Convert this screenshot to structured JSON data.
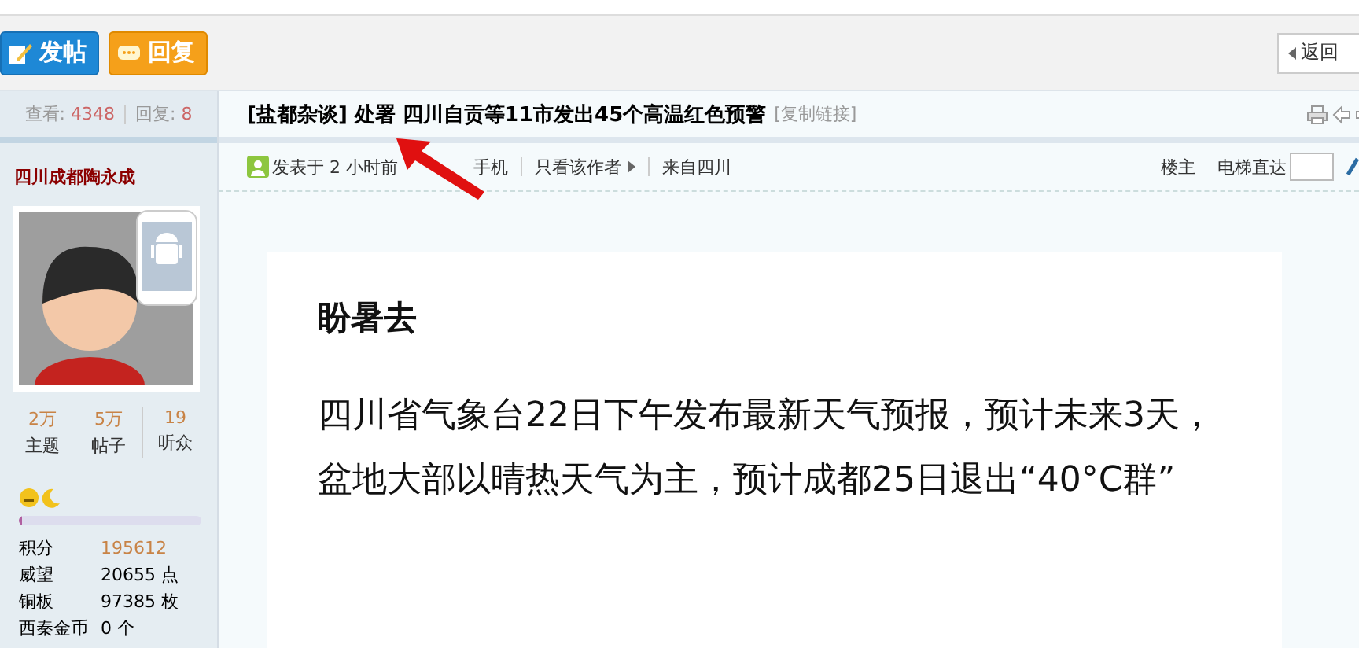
{
  "toolbar": {
    "buttons": [
      {
        "label": "发帖",
        "kind": "post"
      },
      {
        "label": "回复",
        "kind": "reply"
      }
    ],
    "back_button": "返回"
  },
  "thread_stats": {
    "views_label": "查看:",
    "views": "4348",
    "replies_label": "回复:",
    "replies": "8"
  },
  "thread_title": {
    "forum": "[盐都杂谈]",
    "title": "处署 四川自贡等11市发出45个高温红色预警",
    "copy_link": "[复制链接]"
  },
  "author": {
    "name": "四川成都陶永成",
    "stats": [
      {
        "value": "2万",
        "label": "主题"
      },
      {
        "value": "5万",
        "label": "帖子"
      },
      {
        "value": "19",
        "label": "听众"
      }
    ],
    "level": 0.02,
    "info": [
      {
        "label": "积分",
        "value": "195612",
        "highlight": true
      },
      {
        "label": "威望",
        "value": "20655 点",
        "highlight": false
      },
      {
        "label": "铜板",
        "value": "97385 枚",
        "highlight": false
      },
      {
        "label": "西秦金币",
        "value": "0 个",
        "highlight": false
      }
    ]
  },
  "post_meta": {
    "posted": "发表于 2 小时前",
    "device": "手机",
    "only_author": "只看该作者",
    "from": "来自四川",
    "floor": "楼主",
    "jump_label": "电梯直达"
  },
  "post": {
    "heading": "盼暑去",
    "paragraph": "四川省气象台22日下午发布最新天气预报，预计未来3天，盆地大部以晴热天气为主，预计成都25日退出“40°C群”"
  }
}
